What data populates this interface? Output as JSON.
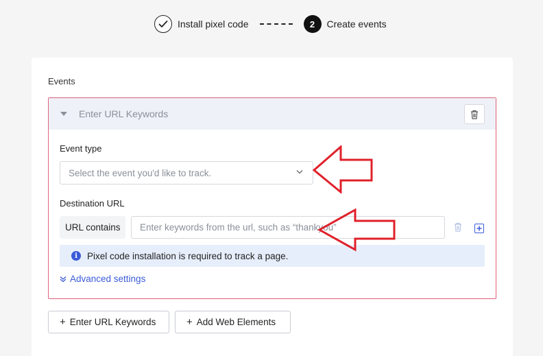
{
  "stepper": {
    "step1_label": "Install pixel code",
    "step2_number": "2",
    "step2_label": "Create events"
  },
  "events": {
    "title": "Events",
    "header_label": "Enter URL Keywords",
    "event_type_label": "Event type",
    "event_type_placeholder": "Select the event you'd like to track.",
    "destination_label": "Destination URL",
    "url_addon": "URL contains",
    "url_placeholder": "Enter keywords from the url, such as “thankyou”",
    "info_text": "Pixel code installation is required to track a page.",
    "info_icon": "i",
    "advanced_label": "Advanced settings"
  },
  "actions": {
    "add_url_keywords": "Enter URL Keywords",
    "add_web_elements": "Add Web Elements"
  },
  "colors": {
    "accent": "#3a5bd9",
    "error_border": "#e0607a",
    "annotation": "#e0202a"
  }
}
